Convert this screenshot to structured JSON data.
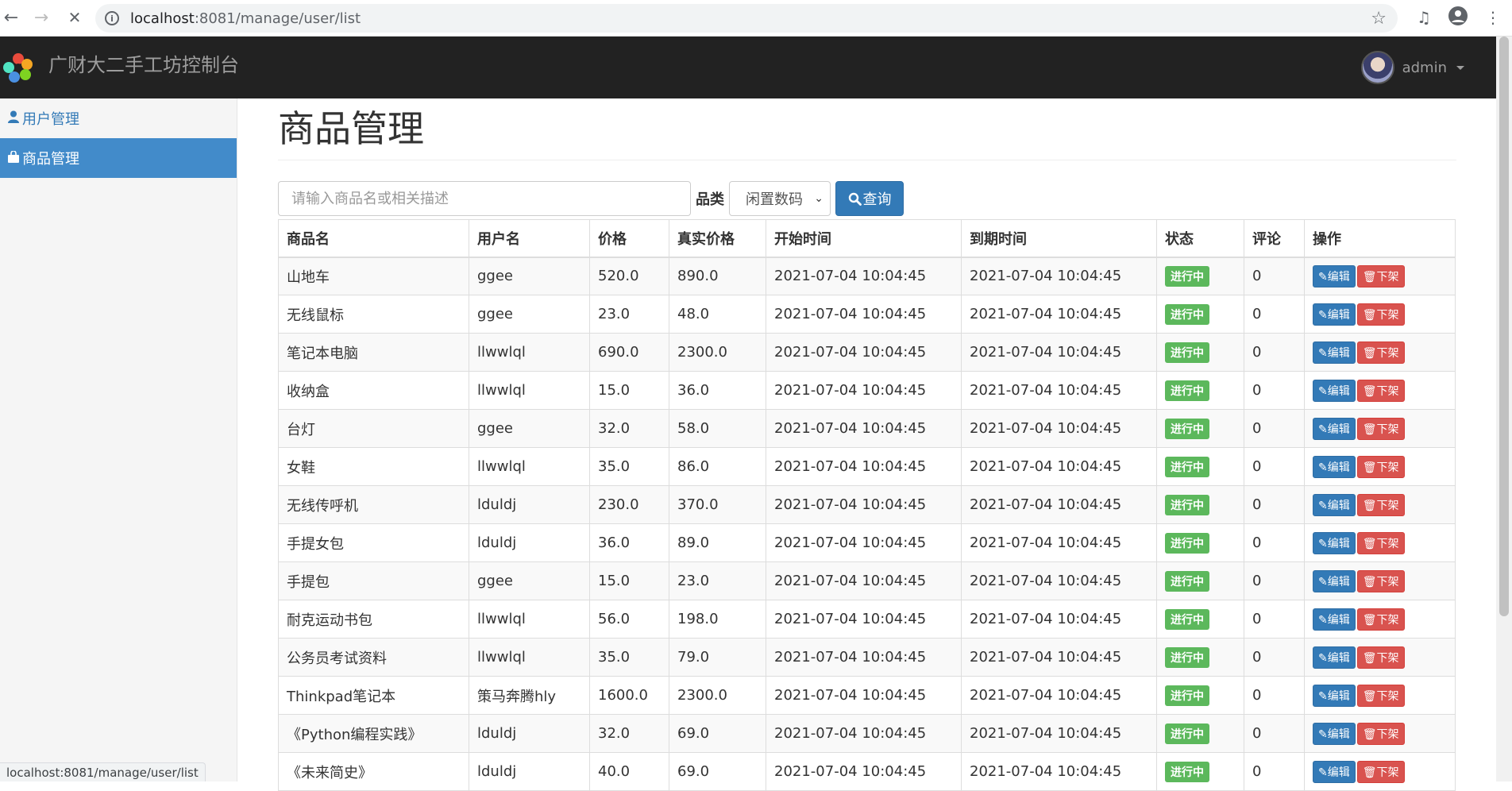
{
  "browser": {
    "url_host": "localhost",
    "url_rest": ":8081/manage/user/list",
    "status_url": "localhost:8081/manage/user/list"
  },
  "app": {
    "brand": "广财大二手工坊控制台",
    "username": "admin"
  },
  "sidebar": {
    "items": [
      {
        "label": "用户管理",
        "icon": "user-icon",
        "active": false
      },
      {
        "label": "商品管理",
        "icon": "shopping-bag-icon",
        "active": true
      }
    ]
  },
  "main": {
    "title": "商品管理",
    "search_placeholder": "请输入商品名或相关描述",
    "category_label": "品类",
    "category_selected": "闲置数码",
    "query_label": "查询"
  },
  "table": {
    "headers": [
      "商品名",
      "用户名",
      "价格",
      "真实价格",
      "开始时间",
      "到期时间",
      "状态",
      "评论",
      "操作"
    ],
    "edit_label": "编辑",
    "offshelf_label": "下架",
    "rows": [
      {
        "name": "山地车",
        "user": "ggee",
        "price": "520.0",
        "real_price": "890.0",
        "start": "2021-07-04 10:04:45",
        "end": "2021-07-04 10:04:45",
        "status": "进行中",
        "comments": "0"
      },
      {
        "name": "无线鼠标",
        "user": "ggee",
        "price": "23.0",
        "real_price": "48.0",
        "start": "2021-07-04 10:04:45",
        "end": "2021-07-04 10:04:45",
        "status": "进行中",
        "comments": "0"
      },
      {
        "name": "笔记本电脑",
        "user": "llwwlql",
        "price": "690.0",
        "real_price": "2300.0",
        "start": "2021-07-04 10:04:45",
        "end": "2021-07-04 10:04:45",
        "status": "进行中",
        "comments": "0"
      },
      {
        "name": "收纳盒",
        "user": "llwwlql",
        "price": "15.0",
        "real_price": "36.0",
        "start": "2021-07-04 10:04:45",
        "end": "2021-07-04 10:04:45",
        "status": "进行中",
        "comments": "0"
      },
      {
        "name": "台灯",
        "user": "ggee",
        "price": "32.0",
        "real_price": "58.0",
        "start": "2021-07-04 10:04:45",
        "end": "2021-07-04 10:04:45",
        "status": "进行中",
        "comments": "0"
      },
      {
        "name": "女鞋",
        "user": "llwwlql",
        "price": "35.0",
        "real_price": "86.0",
        "start": "2021-07-04 10:04:45",
        "end": "2021-07-04 10:04:45",
        "status": "进行中",
        "comments": "0"
      },
      {
        "name": "无线传呼机",
        "user": "lduldj",
        "price": "230.0",
        "real_price": "370.0",
        "start": "2021-07-04 10:04:45",
        "end": "2021-07-04 10:04:45",
        "status": "进行中",
        "comments": "0"
      },
      {
        "name": "手提女包",
        "user": "lduldj",
        "price": "36.0",
        "real_price": "89.0",
        "start": "2021-07-04 10:04:45",
        "end": "2021-07-04 10:04:45",
        "status": "进行中",
        "comments": "0"
      },
      {
        "name": "手提包",
        "user": "ggee",
        "price": "15.0",
        "real_price": "23.0",
        "start": "2021-07-04 10:04:45",
        "end": "2021-07-04 10:04:45",
        "status": "进行中",
        "comments": "0"
      },
      {
        "name": "耐克运动书包",
        "user": "llwwlql",
        "price": "56.0",
        "real_price": "198.0",
        "start": "2021-07-04 10:04:45",
        "end": "2021-07-04 10:04:45",
        "status": "进行中",
        "comments": "0"
      },
      {
        "name": "公务员考试资料",
        "user": "llwwlql",
        "price": "35.0",
        "real_price": "79.0",
        "start": "2021-07-04 10:04:45",
        "end": "2021-07-04 10:04:45",
        "status": "进行中",
        "comments": "0"
      },
      {
        "name": "Thinkpad笔记本",
        "user": "策马奔腾hly",
        "price": "1600.0",
        "real_price": "2300.0",
        "start": "2021-07-04 10:04:45",
        "end": "2021-07-04 10:04:45",
        "status": "进行中",
        "comments": "0"
      },
      {
        "name": "《Python编程实践》",
        "user": "lduldj",
        "price": "32.0",
        "real_price": "69.0",
        "start": "2021-07-04 10:04:45",
        "end": "2021-07-04 10:04:45",
        "status": "进行中",
        "comments": "0"
      },
      {
        "name": "《未来简史》",
        "user": "lduldj",
        "price": "40.0",
        "real_price": "69.0",
        "start": "2021-07-04 10:04:45",
        "end": "2021-07-04 10:04:45",
        "status": "进行中",
        "comments": "0"
      }
    ]
  },
  "colors": {
    "navbar_bg": "#222222",
    "primary": "#337ab7",
    "active_nav": "#428bca",
    "success": "#5cb85c",
    "danger": "#d9534f"
  }
}
